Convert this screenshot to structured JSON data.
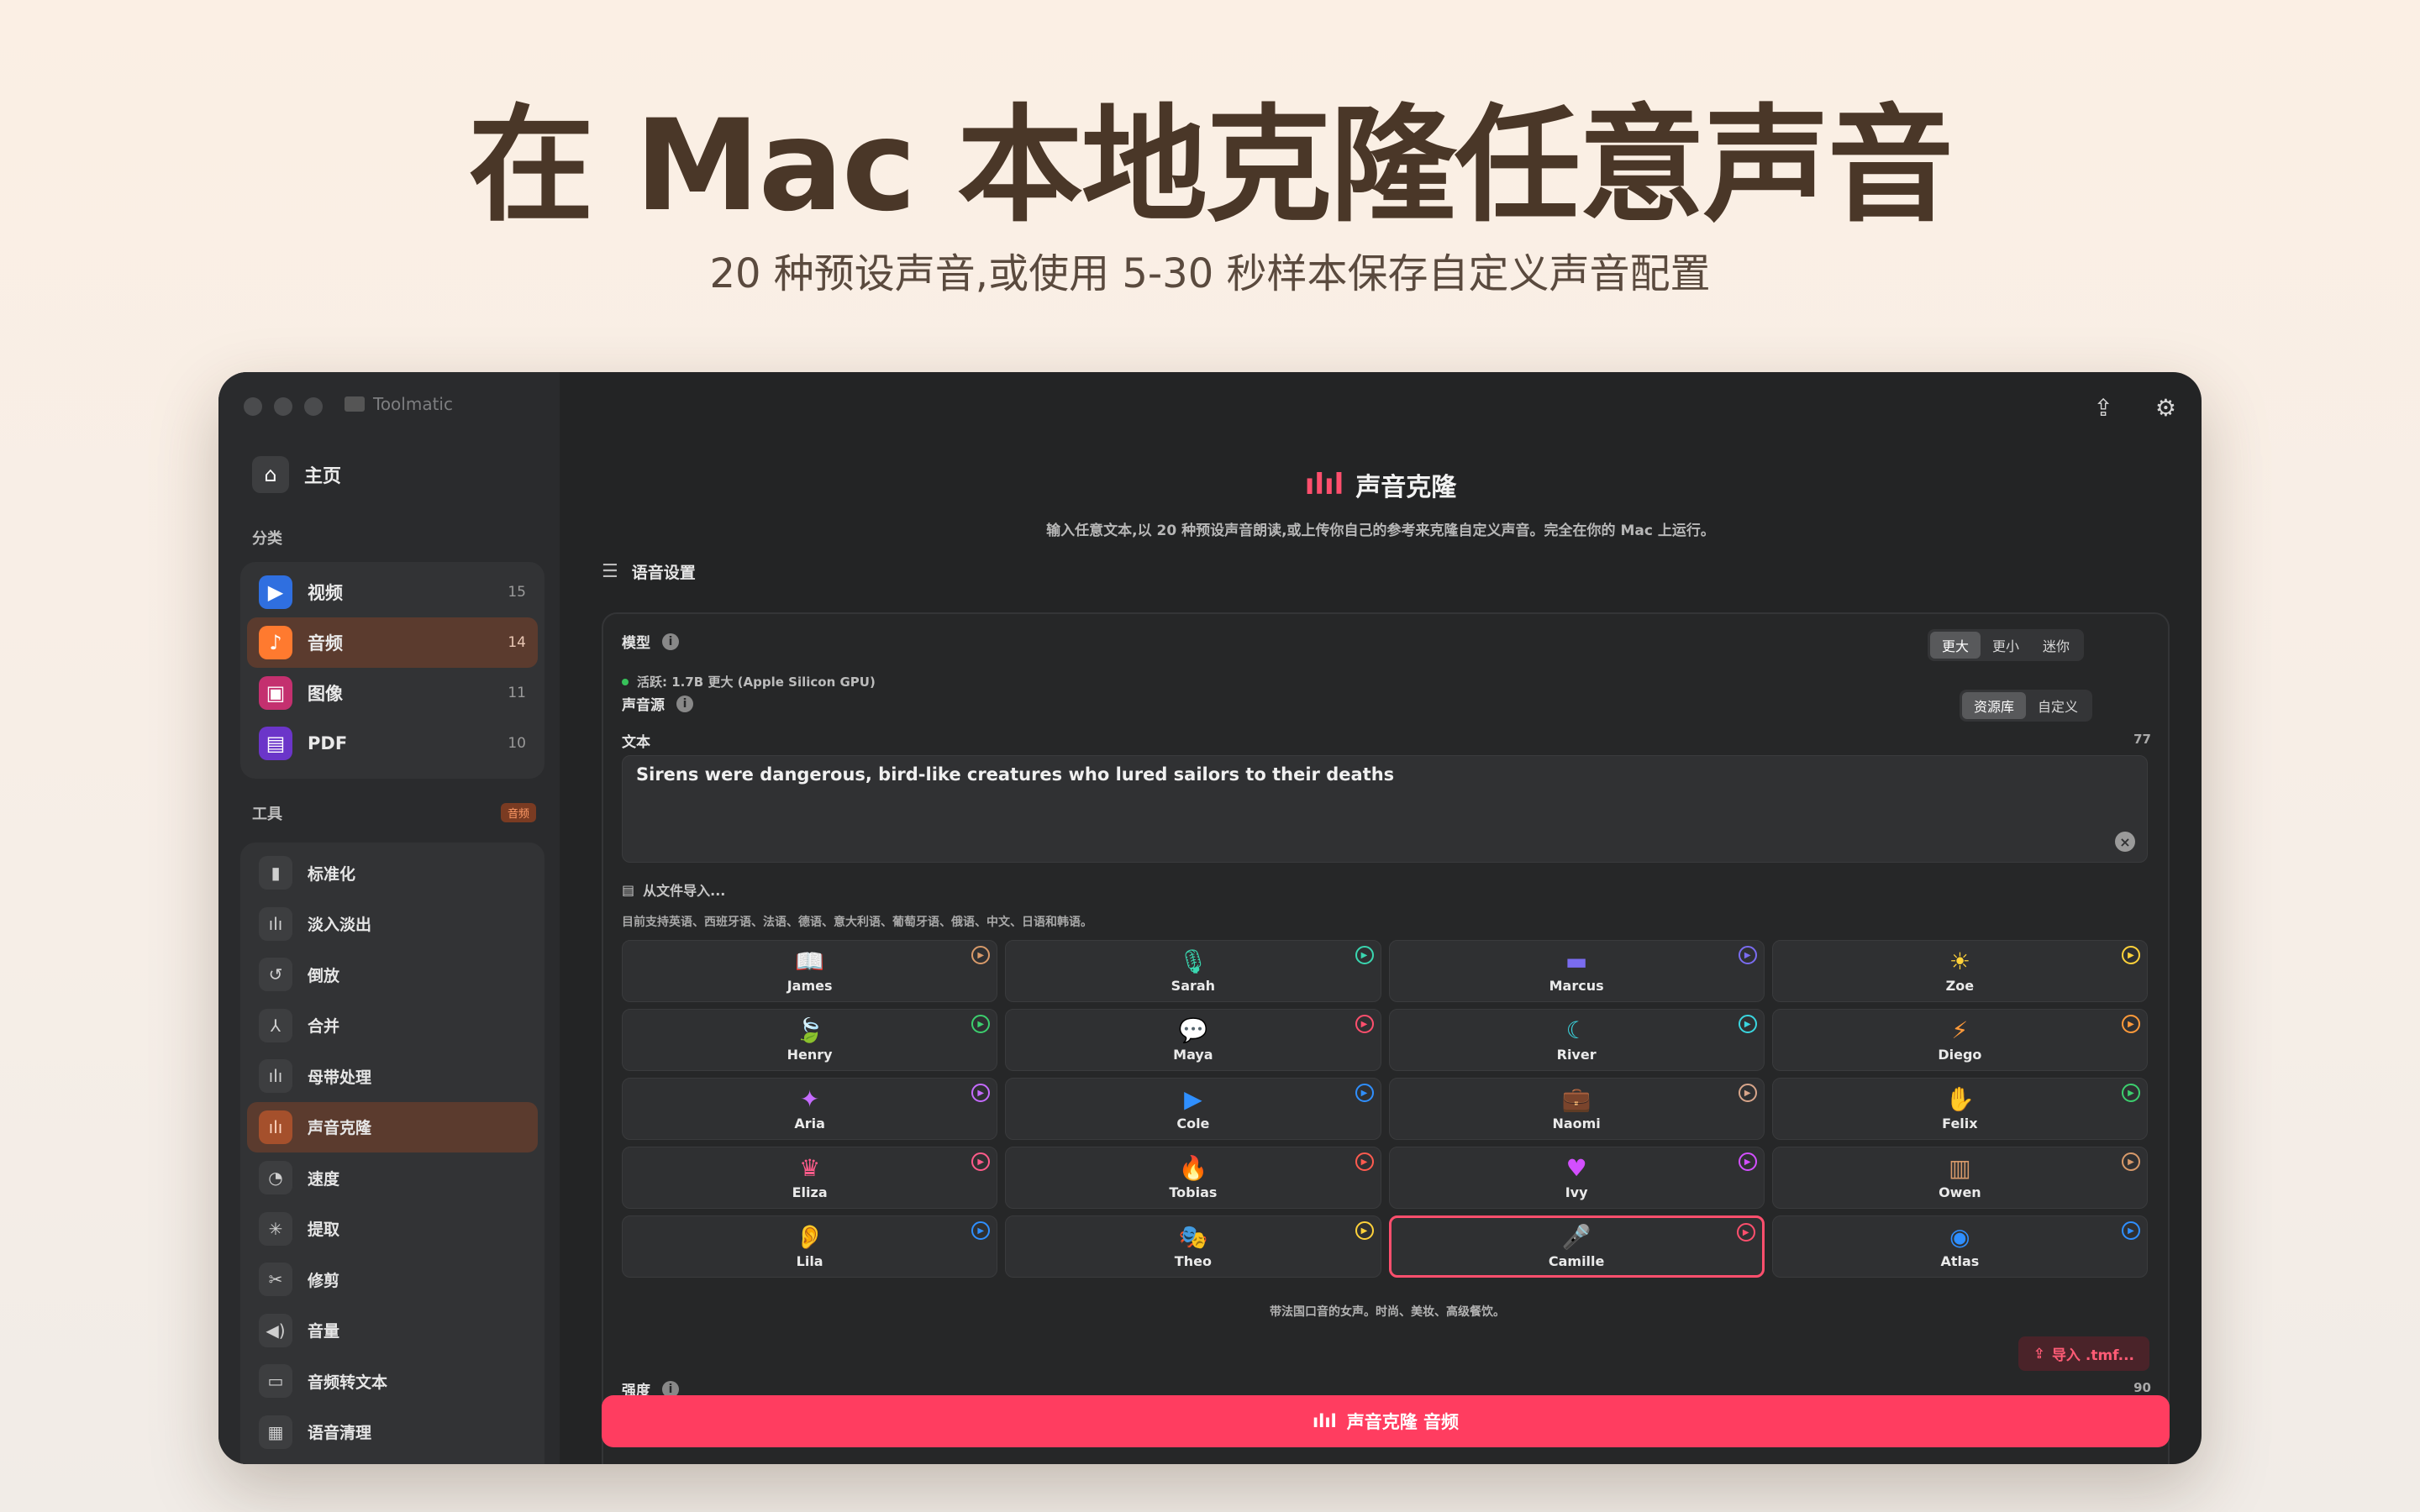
{
  "hero": {
    "title": "在 Mac 本地克隆任意声音",
    "subtitle": "20 种预设声音,或使用 5-30 秒样本保存自定义声音配置"
  },
  "app": {
    "name": "Toolmatic"
  },
  "sidebar": {
    "home_label": "主页",
    "categories_label": "分类",
    "categories": [
      {
        "label": "视频",
        "count": "15",
        "color": "#2f6fe0",
        "icon": "video-icon"
      },
      {
        "label": "音频",
        "count": "14",
        "color": "#ff7a2f",
        "icon": "music-icon"
      },
      {
        "label": "图像",
        "count": "11",
        "color": "#c4306f",
        "icon": "image-icon"
      },
      {
        "label": "PDF",
        "count": "10",
        "color": "#6b35c9",
        "icon": "pdf-icon"
      }
    ],
    "tools_label": "工具",
    "tools_badge": "音频",
    "tools": [
      {
        "label": "标准化",
        "icon": "normalize-icon"
      },
      {
        "label": "淡入淡出",
        "icon": "fade-icon"
      },
      {
        "label": "倒放",
        "icon": "reverse-icon"
      },
      {
        "label": "合并",
        "icon": "merge-icon"
      },
      {
        "label": "母带处理",
        "icon": "mastering-icon"
      },
      {
        "label": "声音克隆",
        "icon": "voice-clone-icon"
      },
      {
        "label": "速度",
        "icon": "speed-icon"
      },
      {
        "label": "提取",
        "icon": "extract-icon"
      },
      {
        "label": "修剪",
        "icon": "scissors-icon"
      },
      {
        "label": "音量",
        "icon": "volume-icon"
      },
      {
        "label": "音频转文本",
        "icon": "transcribe-icon"
      },
      {
        "label": "语音清理",
        "icon": "cleanup-icon"
      }
    ]
  },
  "main": {
    "title": "声音克隆",
    "description": "输入任意文本,以 20 种预设声音朗读,或上传你自己的参考来克隆自定义声音。完全在你的 Mac 上运行。",
    "settings_label": "语音设置",
    "model_label": "模型",
    "model_status": "活跃: 1.7B 更大 (Apple Silicon GPU)",
    "model_options": [
      "更大",
      "更小",
      "迷你"
    ],
    "source_label": "声音源",
    "source_options": [
      "资源库",
      "自定义"
    ],
    "text_label": "文本",
    "text_count": "77",
    "text_value": "Sirens were dangerous, bird-like creatures who lured sailors to their deaths",
    "import_file": "从文件导入...",
    "languages": "目前支持英语、西班牙语、法语、德语、意大利语、葡萄牙语、俄语、中文、日语和韩语。",
    "voices": [
      {
        "name": "James",
        "icon": "📖",
        "color": "#d89a6a"
      },
      {
        "name": "Sarah",
        "icon": "🎙",
        "color": "#3ad6b0"
      },
      {
        "name": "Marcus",
        "icon": "▬",
        "color": "#7a6cf0"
      },
      {
        "name": "Zoe",
        "icon": "☀",
        "color": "#ffd23a"
      },
      {
        "name": "Henry",
        "icon": "🍃",
        "color": "#3ccf6e"
      },
      {
        "name": "Maya",
        "icon": "💬",
        "color": "#ff4f6d"
      },
      {
        "name": "River",
        "icon": "☾",
        "color": "#3ad6e0"
      },
      {
        "name": "Diego",
        "icon": "⚡",
        "color": "#ff9a3a"
      },
      {
        "name": "Aria",
        "icon": "✦",
        "color": "#c56bff"
      },
      {
        "name": "Cole",
        "icon": "▶",
        "color": "#2f8fff"
      },
      {
        "name": "Naomi",
        "icon": "💼",
        "color": "#d8a58a"
      },
      {
        "name": "Felix",
        "icon": "✋",
        "color": "#3ccf6e"
      },
      {
        "name": "Eliza",
        "icon": "♛",
        "color": "#ff5b8a"
      },
      {
        "name": "Tobias",
        "icon": "🔥",
        "color": "#ff5b4f"
      },
      {
        "name": "Ivy",
        "icon": "♥",
        "color": "#d34fff"
      },
      {
        "name": "Owen",
        "icon": "▥",
        "color": "#d89a6a"
      },
      {
        "name": "Lila",
        "icon": "👂",
        "color": "#2f8fff"
      },
      {
        "name": "Theo",
        "icon": "🎭",
        "color": "#ffd23a"
      },
      {
        "name": "Camille",
        "icon": "🎤",
        "color": "#ff4f6d",
        "selected": true
      },
      {
        "name": "Atlas",
        "icon": "◉",
        "color": "#2f8fff"
      }
    ],
    "voice_caption": "带法国口音的女声。时尚、美妆、高级餐饮。",
    "import_tmf": "导入 .tmf...",
    "strength_label": "强度",
    "strength_value": "90",
    "cta_label": "声音克隆 音频"
  }
}
